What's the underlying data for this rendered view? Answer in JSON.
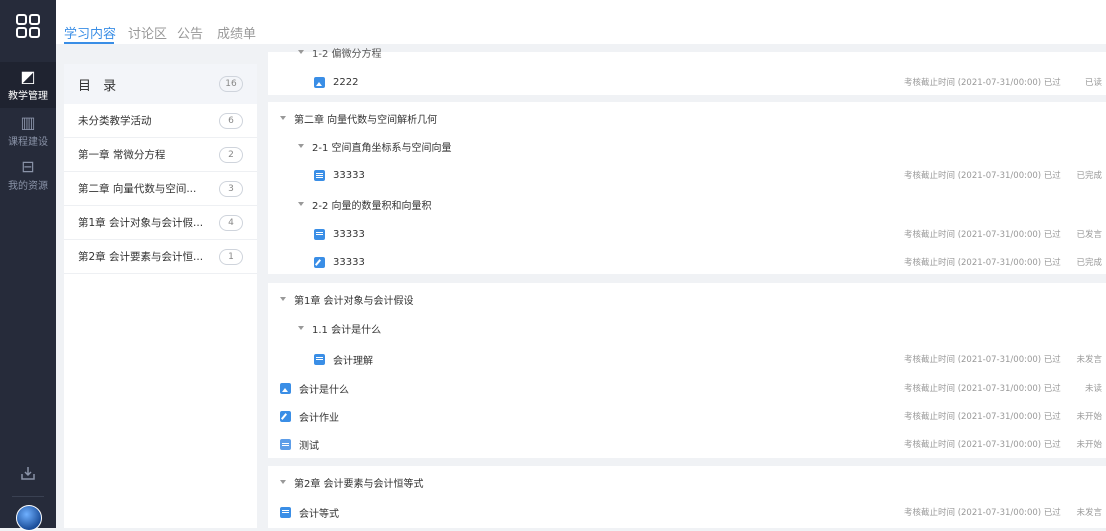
{
  "rail": {
    "items": [
      {
        "label": "教学管理",
        "icon": "teaching-icon"
      },
      {
        "label": "课程建设",
        "icon": "book-icon"
      },
      {
        "label": "我的资源",
        "icon": "box-icon"
      }
    ]
  },
  "tabs": [
    "学习内容",
    "讨论区",
    "公告",
    "成绩单"
  ],
  "directory": {
    "title": "目 录",
    "count": "16",
    "items": [
      {
        "label": "未分类教学活动",
        "count": "6"
      },
      {
        "label": "第一章 常微分方程",
        "count": "2"
      },
      {
        "label": "第二章 向量代数与空间...",
        "count": "3"
      },
      {
        "label": "第1章 会计对象与会计假...",
        "count": "4"
      },
      {
        "label": "第2章 会计要素与会计恒...",
        "count": "1"
      }
    ]
  },
  "content": {
    "partial_header": "1-2 偏微分方程",
    "partial_item": {
      "title": "2222",
      "deadline": "考核截止时间 (2021-07-31/00:00) 已过",
      "status": "已读"
    },
    "ch2": {
      "title": "第二章 向量代数与空间解析几何",
      "sec1": "2-1 空间直角坐标系与空间向量",
      "item1": {
        "title": "33333",
        "deadline": "考核截止时间 (2021-07-31/00:00) 已过",
        "status": "已完成"
      },
      "sec2": "2-2 向量的数量积和向量积",
      "item2": {
        "title": "33333",
        "deadline": "考核截止时间 (2021-07-31/00:00) 已过",
        "status": "已发言"
      },
      "item3": {
        "title": "33333",
        "deadline": "考核截止时间 (2021-07-31/00:00) 已过",
        "status": "已完成"
      }
    },
    "acc1": {
      "title": "第1章 会计对象与会计假设",
      "sec1": "1.1 会计是什么",
      "item1": {
        "title": "会计理解",
        "deadline": "考核截止时间 (2021-07-31/00:00) 已过",
        "status": "未发言"
      },
      "item2": {
        "title": "会计是什么",
        "deadline": "考核截止时间 (2021-07-31/00:00) 已过",
        "status": "未读"
      },
      "item3": {
        "title": "会计作业",
        "deadline": "考核截止时间 (2021-07-31/00:00) 已过",
        "status": "未开始"
      },
      "item4": {
        "title": "测试",
        "deadline": "考核截止时间 (2021-07-31/00:00) 已过",
        "status": "未开始"
      }
    },
    "acc2": {
      "title": "第2章 会计要素与会计恒等式",
      "item1": {
        "title": "会计等式",
        "deadline": "考核截止时间 (2021-07-31/00:00) 已过",
        "status": "未发言"
      }
    }
  }
}
